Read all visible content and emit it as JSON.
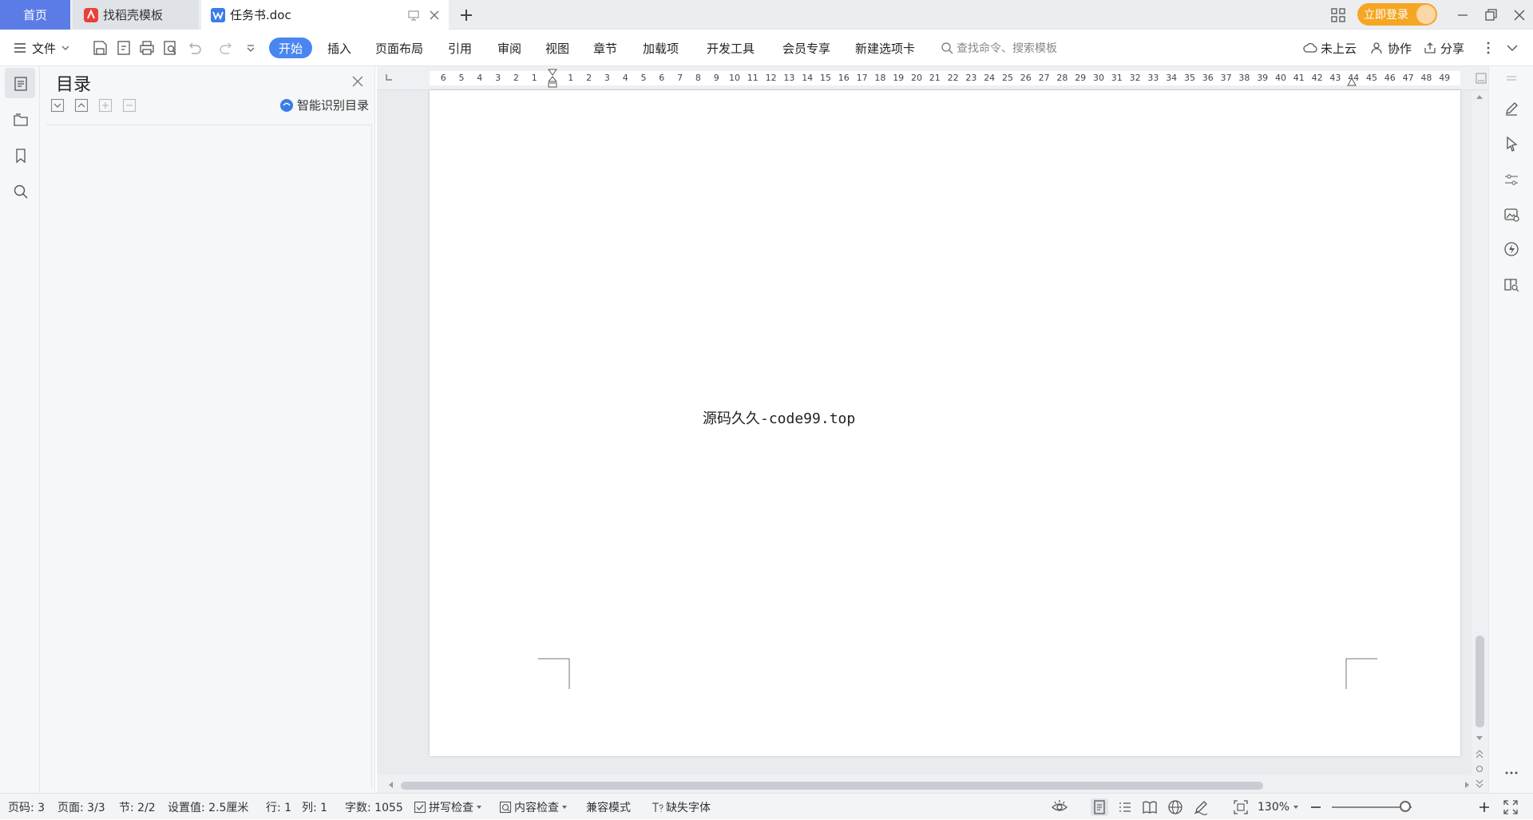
{
  "tabs": {
    "home": "首页",
    "template": "找稻壳模板",
    "doc": "任务书.doc",
    "login": "立即登录"
  },
  "menu": {
    "file": "文件",
    "items": [
      "开始",
      "插入",
      "页面布局",
      "引用",
      "审阅",
      "视图",
      "章节",
      "加载项",
      "开发工具",
      "会员专享",
      "新建选项卡"
    ],
    "search_placeholder": "查找命令、搜索模板",
    "cloud": "未上云",
    "collab": "协作",
    "share": "分享"
  },
  "toc": {
    "title": "目录",
    "smart": "智能识别目录"
  },
  "ruler": {
    "left_ticks": [
      "6",
      "5",
      "4",
      "3",
      "2",
      "1"
    ],
    "right_ticks": [
      "1",
      "2",
      "3",
      "4",
      "5",
      "6",
      "7",
      "8",
      "9",
      "10",
      "11",
      "12",
      "13",
      "14",
      "15",
      "16",
      "17",
      "18",
      "19",
      "20",
      "21",
      "22",
      "23",
      "24",
      "25",
      "26",
      "27",
      "28",
      "29",
      "30",
      "31",
      "32",
      "33",
      "34",
      "35",
      "36",
      "37",
      "38",
      "39",
      "40",
      "41",
      "42",
      "43",
      "44",
      "45",
      "46",
      "47",
      "48",
      "49"
    ]
  },
  "document": {
    "text": "源码久久-code99.top"
  },
  "status": {
    "page_code": "页码: 3",
    "pages": "页面: 3/3",
    "section": "节: 2/2",
    "setting": "设置值: 2.5厘米",
    "row": "行: 1",
    "col": "列: 1",
    "words": "字数: 1055",
    "spell": "拼写检查",
    "content": "内容检查",
    "compat": "兼容模式",
    "missing_font": "缺失字体",
    "zoom": "130%"
  },
  "colors": {
    "accent": "#4a86f2",
    "home_tab": "#5b7ce6",
    "login": "#f5a623",
    "wps_red": "#e8413a",
    "wps_blue": "#3b7de8"
  }
}
